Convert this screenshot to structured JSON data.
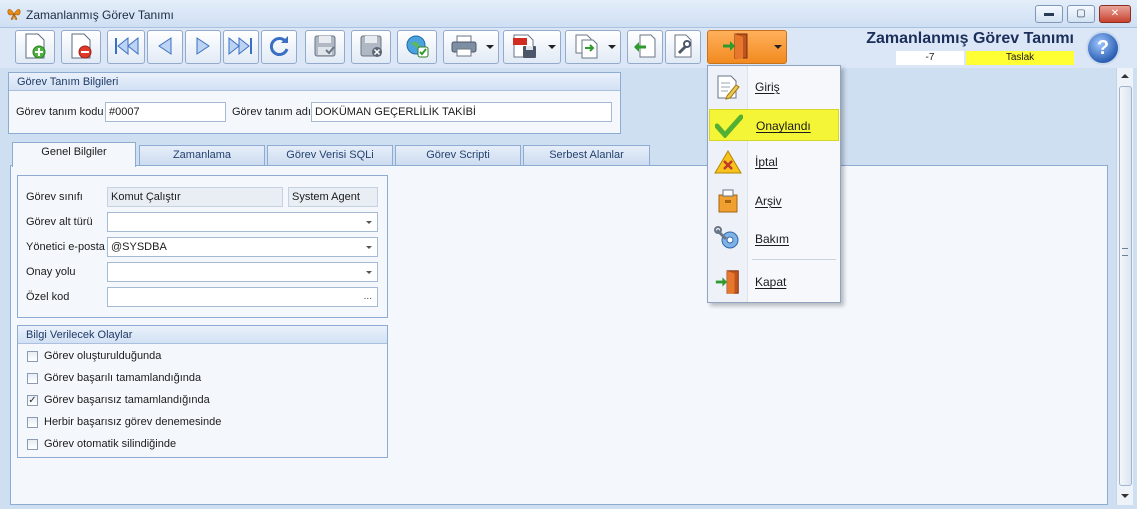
{
  "window": {
    "title": "Zamanlanmış Görev Tanımı",
    "controls": {
      "minimize": "▬",
      "maximize": "▢",
      "close": "✕"
    }
  },
  "toolbar": {
    "buttons": [
      {
        "name": "new-icon"
      },
      {
        "name": "delete-icon"
      },
      {
        "name": "first-record-icon"
      },
      {
        "name": "previous-record-icon"
      },
      {
        "name": "next-record-icon"
      },
      {
        "name": "last-record-icon"
      },
      {
        "name": "refresh-icon"
      },
      {
        "name": "save-icon"
      },
      {
        "name": "save-close-icon"
      },
      {
        "name": "web-check-icon"
      },
      {
        "name": "print-icon"
      },
      {
        "name": "pdf-export-icon"
      },
      {
        "name": "copy-export-icon"
      },
      {
        "name": "import-icon"
      },
      {
        "name": "tools-icon"
      },
      {
        "name": "exit-door-icon"
      }
    ]
  },
  "header": {
    "title": "Zamanlanmış Görev Tanımı",
    "record_number": "-7",
    "status": "Taslak",
    "help_label": "?"
  },
  "definition": {
    "group_title": "Görev Tanım Bilgileri",
    "code_label": "Görev tanım kodu",
    "code_value": "#0007",
    "name_label": "Görev tanım adı",
    "name_value": "DOKÜMAN GEÇERLİLİK TAKİBİ"
  },
  "tabs": [
    {
      "label": "Genel Bilgiler",
      "active": true
    },
    {
      "label": "Zamanlama",
      "active": false
    },
    {
      "label": "Görev Verisi SQLi",
      "active": false
    },
    {
      "label": "Görev Scripti",
      "active": false
    },
    {
      "label": "Serbest Alanlar",
      "active": false
    }
  ],
  "general": {
    "class_label": "Görev sınıfı",
    "class_value": "Komut Çalıştır",
    "class_agent": "System Agent",
    "subtype_label": "Görev alt türü",
    "subtype_value": "",
    "email_label": "Yönetici e-posta",
    "email_value": "@SYSDBA",
    "approval_label": "Onay yolu",
    "approval_value": "",
    "special_label": "Özel kod",
    "special_value": "",
    "ellipsis": "..."
  },
  "events": {
    "group_title": "Bilgi Verilecek Olaylar",
    "items": [
      {
        "label": "Görev oluşturulduğunda",
        "checked": false
      },
      {
        "label": "Görev başarılı tamamlandığında",
        "checked": false
      },
      {
        "label": "Görev başarısız tamamlandığında",
        "checked": true
      },
      {
        "label": "Herbir başarısız görev denemesinde",
        "checked": false
      },
      {
        "label": "Görev otomatik silindiğinde",
        "checked": false
      }
    ],
    "check_mark": "✓"
  },
  "status_menu": {
    "items": [
      {
        "label": "Giriş",
        "icon": "edit-document-icon",
        "highlighted": false
      },
      {
        "label": "Onaylandı",
        "icon": "checkmark-icon",
        "highlighted": true
      },
      {
        "label": "İptal",
        "icon": "cancel-warning-icon",
        "highlighted": false
      },
      {
        "label": "Arşiv",
        "icon": "archive-box-icon",
        "highlighted": false
      },
      {
        "label": "Bakım",
        "icon": "maintenance-gear-icon",
        "highlighted": false
      },
      {
        "label": "Kapat",
        "icon": "exit-door-icon",
        "highlighted": false
      }
    ]
  },
  "colors": {
    "status_yellow": "#ffff33",
    "menu_highlight": "#f5f537",
    "exit_orange": "#f28a1f",
    "accent_blue": "#1c2f5a"
  }
}
